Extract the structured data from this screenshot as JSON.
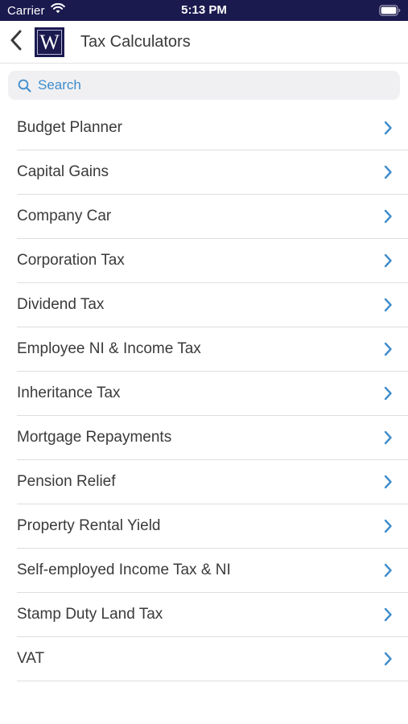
{
  "status_bar": {
    "carrier": "Carrier",
    "time": "5:13 PM"
  },
  "nav": {
    "back_icon": "chevron-left-icon",
    "logo_letter": "W",
    "title": "Tax Calculators"
  },
  "search": {
    "placeholder": "Search",
    "icon": "search-icon"
  },
  "calculators": [
    {
      "label": "Budget Planner"
    },
    {
      "label": "Capital Gains"
    },
    {
      "label": "Company Car"
    },
    {
      "label": "Corporation Tax"
    },
    {
      "label": "Dividend Tax"
    },
    {
      "label": "Employee NI & Income Tax"
    },
    {
      "label": "Inheritance Tax"
    },
    {
      "label": "Mortgage Repayments"
    },
    {
      "label": "Pension Relief"
    },
    {
      "label": "Property Rental Yield"
    },
    {
      "label": "Self-employed Income Tax & NI"
    },
    {
      "label": "Stamp Duty Land Tax"
    },
    {
      "label": "VAT"
    }
  ],
  "colors": {
    "brand_navy": "#1b1a4f",
    "accent_blue": "#3f8dcc",
    "text": "#3a3a3c",
    "separator": "#dedee2"
  }
}
